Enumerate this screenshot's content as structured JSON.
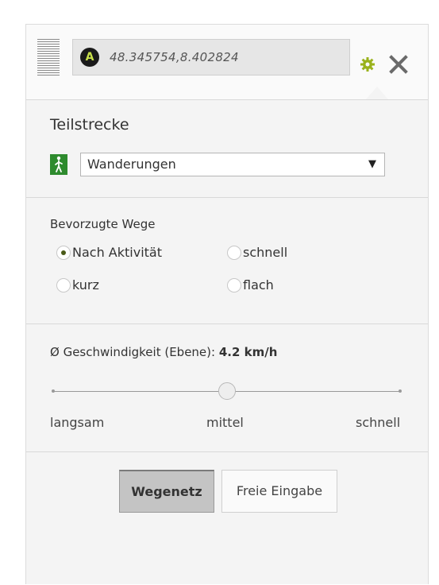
{
  "waypoint": {
    "marker": "A",
    "value": "48.345754,8.402824"
  },
  "segment": {
    "title": "Teilstrecke",
    "activity_select": {
      "selected": "Wanderungen"
    }
  },
  "preferred_routes": {
    "label": "Bevorzugte Wege",
    "options": [
      {
        "label": "Nach Aktivität",
        "selected": true
      },
      {
        "label": "schnell",
        "selected": false
      },
      {
        "label": "kurz",
        "selected": false
      },
      {
        "label": "flach",
        "selected": false
      }
    ]
  },
  "speed": {
    "label": "Ø Geschwindigkeit (Ebene):",
    "value": "4.2 km/h",
    "slider_level_fraction": 0.5,
    "tick_labels": [
      "langsam",
      "mittel",
      "schnell"
    ]
  },
  "mode_buttons": {
    "path_network": "Wegenetz",
    "free_input": "Freie Eingabe",
    "active": "Wegenetz"
  },
  "colors": {
    "accent_green": "#2e8b2e",
    "marker_yellow": "#c8e04a",
    "gear_olive": "#9ab21c"
  }
}
